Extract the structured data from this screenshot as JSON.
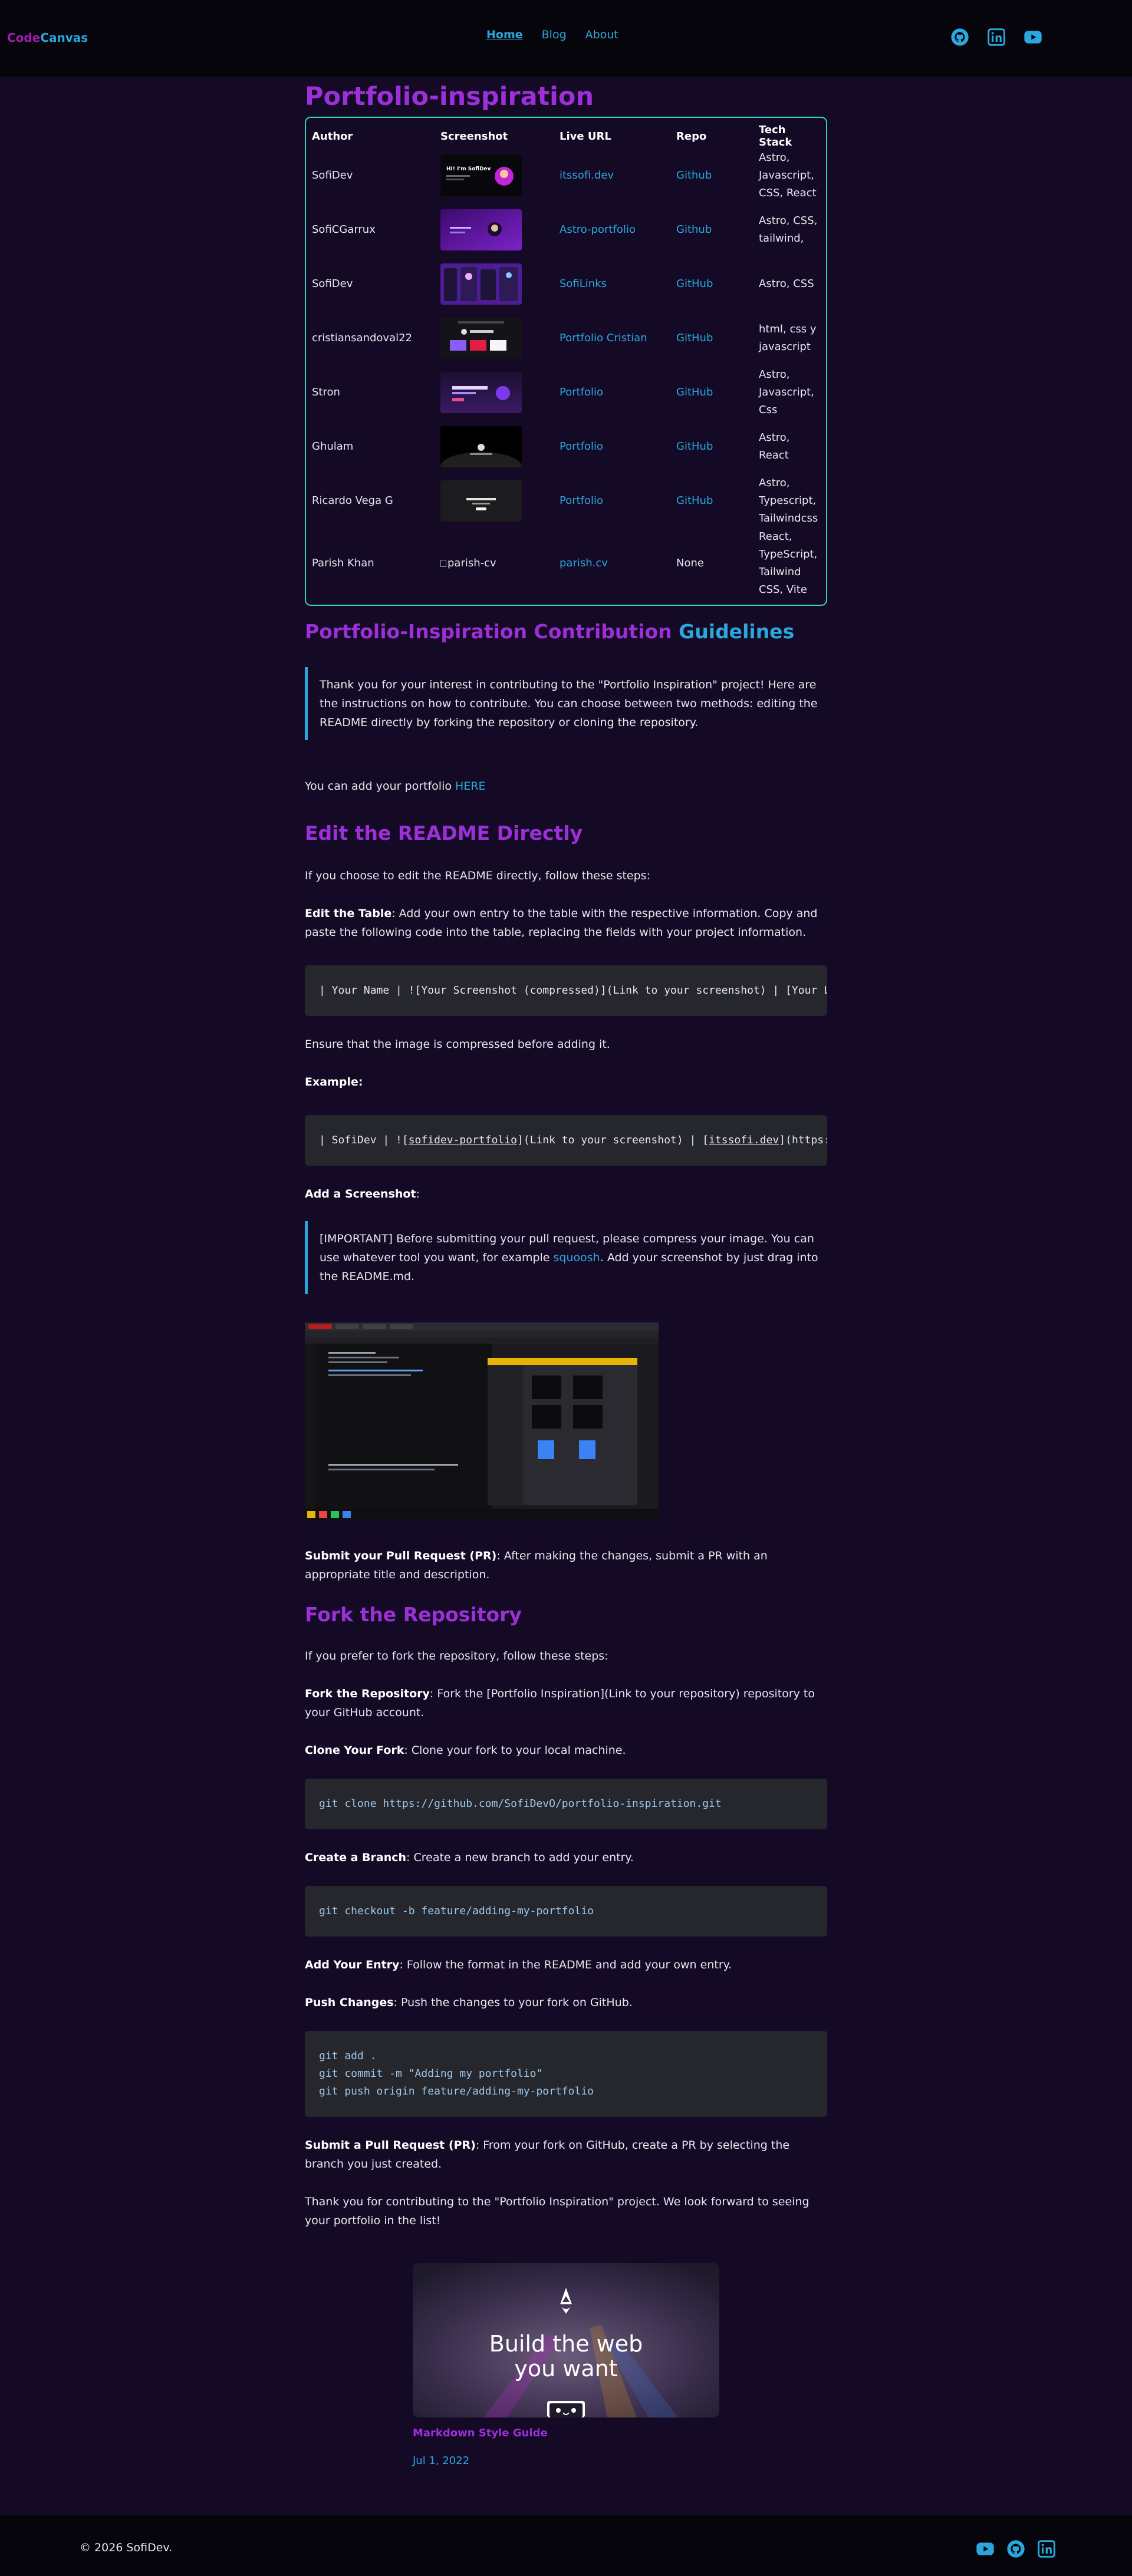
{
  "header": {
    "logo_part1": "Code",
    "logo_part2": "Canvas",
    "nav": [
      "Home",
      "Blog",
      "About"
    ]
  },
  "main": {
    "title": "Portfolio-inspiration",
    "table": {
      "headers": [
        "Author",
        "Screenshot",
        "Live URL",
        "Repo",
        "Tech Stack"
      ],
      "rows": [
        {
          "author": "SofiDev",
          "live": "itssofi.dev",
          "repo": "Github",
          "tech": "Astro, Javascript, CSS, React"
        },
        {
          "author": "SofiCGarrux",
          "live": "Astro-portfolio",
          "repo": "Github",
          "tech": "Astro, CSS, tailwind,"
        },
        {
          "author": "SofiDev",
          "live": "SofiLinks",
          "repo": "GitHub",
          "tech": "Astro, CSS"
        },
        {
          "author": "cristiansandoval22",
          "live": "Portfolio Cristian",
          "repo": "GitHub",
          "tech": "html, css y javascript"
        },
        {
          "author": "Stron",
          "live": "Portfolio",
          "repo": "GitHub",
          "tech": "Astro, Javascript, Css"
        },
        {
          "author": "Ghulam",
          "live": "Portfolio",
          "repo": "GitHub",
          "tech": "Astro, React"
        },
        {
          "author": "Ricardo Vega G",
          "live": "Portfolio",
          "repo": "GitHub",
          "tech": "Astro, Typescript, Tailwindcss"
        },
        {
          "author": "Parish Khan",
          "screenshot_alt": "parish-cv",
          "live": "parish.cv",
          "repo": "None",
          "tech": "React, TypeScript, Tailwind CSS, Vite"
        }
      ]
    },
    "contrib_heading_part1": "Portfolio-Inspiration Contribution",
    "contrib_heading_part2": "Guidelines",
    "intro_quote": "Thank you for your interest in contributing to the \"Portfolio Inspiration\" project! Here are the instructions on how to contribute. You can choose between two methods: editing the README directly by forking the repository or cloning the repository.",
    "add_portfolio_text": "You can add your portfolio",
    "add_portfolio_link": "HERE",
    "edit_heading": "Edit the README Directly",
    "edit_intro": "If you choose to edit the README directly, follow these steps:",
    "edit_table_label": "Edit the Table",
    "edit_table_text": ": Add your own entry to the table with the respective information. Copy and paste the following code into the table, replacing the fields with your project information.",
    "code_table_row": "| Your Name | ![Your Screenshot (compressed)](Link to your screenshot) | [Your Live URL](Link to your website) | [Github](Link to your repository) | Your Tech Stack |",
    "compress_note": "Ensure that the image is compressed before adding it.",
    "example_label": "Example:",
    "example_code_prefix": "| SofiDev | ![",
    "example_code_link1": "sofidev-portfolio",
    "example_code_mid": "](Link to your screenshot) | [",
    "example_code_link2": "itssofi.dev",
    "example_code_suffix": "](https://itssofi.dev) | [Github](https://github.com/SofiDevO) | Astro, Javascript, CSS, React |",
    "add_screenshot_label": "Add a Screenshot",
    "important_quote_before": "[IMPORTANT] Before submitting your pull request, please compress your image. You can use whatever tool you want, for example",
    "important_quote_link": "squoosh",
    "important_quote_after": ". Add your screenshot by just drag into the README.md.",
    "submit_pr_label": "Submit your Pull Request (PR)",
    "submit_pr_text": ": After making the changes, submit a PR with an appropriate title and description.",
    "fork_heading": "Fork the Repository",
    "fork_intro": "If you prefer to fork the repository, follow these steps:",
    "fork_label": "Fork the Repository",
    "fork_text": ": Fork the [Portfolio Inspiration](Link to your repository) repository to your GitHub account.",
    "clone_label": "Clone Your Fork",
    "clone_text": ": Clone your fork to your local machine.",
    "code_clone": "git clone https://github.com/SofiDevO/portfolio-inspiration.git",
    "branch_label": "Create a Branch",
    "branch_text": ": Create a new branch to add your entry.",
    "code_branch": "git checkout -b feature/adding-my-portfolio",
    "entry_label": "Add Your Entry",
    "entry_text": ": Follow the format in the README and add your own entry.",
    "push_label": "Push Changes",
    "push_text": ": Push the changes to your fork on GitHub.",
    "code_push": "git add .\ngit commit -m \"Adding my portfolio\"\ngit push origin feature/adding-my-portfolio",
    "final_pr_label": "Submit a Pull Request (PR)",
    "final_pr_text": ": From your fork on GitHub, create a PR by selecting the branch you just created.",
    "thanks_text": "Thank you for contributing to the \"Portfolio Inspiration\" project. We look forward to seeing your portfolio in the list!",
    "card": {
      "image_line1": "Build the web",
      "image_line2": "you want",
      "title": "Markdown Style Guide",
      "date": "Jul 1, 2022"
    }
  },
  "footer": {
    "copyright": "© 2026 SofiDev."
  },
  "colors": {
    "purple": "#9d2fd9",
    "blue": "#2aa8de",
    "teal_border": "#2dd4bf",
    "background": "#150a26"
  }
}
